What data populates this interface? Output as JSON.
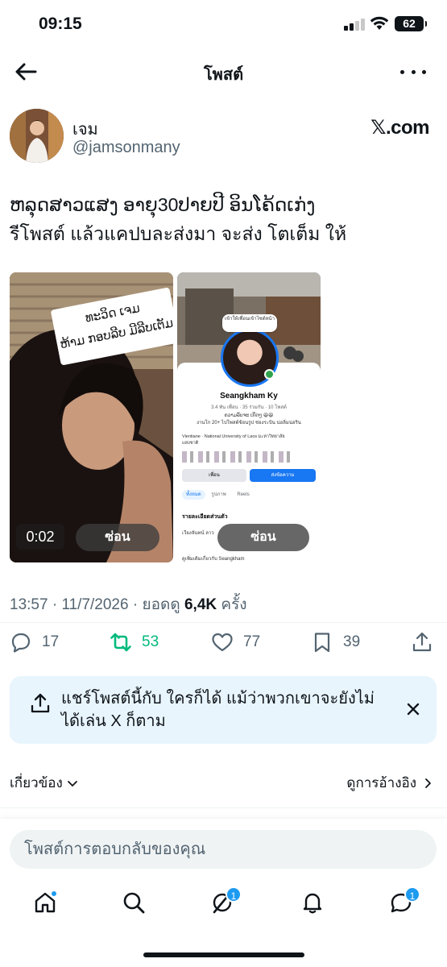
{
  "status_bar": {
    "time": "09:15",
    "battery": "62"
  },
  "header": {
    "title": "โพสต์"
  },
  "author": {
    "name": "เจม",
    "handle": "@jamsonmany",
    "source_badge": "𝕏.com"
  },
  "post": {
    "text_line1": "ຫລຸດສາວແສງ ອາຍຸ30ປາຍປີ ອິນໂຄ້ດເກ່ງ",
    "text_line2": "รีโพสต์  แล้วแคปบละส่งมา จะส่ง โตเต็ม ให้"
  },
  "media": {
    "left": {
      "video_time": "0:02",
      "hide_label": "ซ่อน",
      "sticker_line1": "ທະວິດ ເຈມ",
      "sticker_line2": "ຫ້າມ ກອບລີບ ມີລີບເຕັມ"
    },
    "right": {
      "hide_label": "ซ่อน",
      "profile_name": "Seangkham Ky",
      "profile_stats": "3.4 พัน เพื่อน · 35 ร่วมกัน · 10 โพสต์",
      "profile_bubble": "เข้าให้เพื่อนเข้าไซต์หน้า",
      "profile_bio_1": "ຄວາມລັບຈະ ເກີດໆ 😆😆",
      "profile_bio_2": "งานโก 20+ ไปโพสต์ช้อนรูป ช่องระบิน น่อลิ่มน่อริน",
      "profile_info_1": "Vientiane · National University of Laos มะหาวิทยาลัย",
      "profile_info_2": "แห่งชาติ",
      "friends_btn": "เพื่อน",
      "message_btn": "ส่งข้อความ",
      "tab_all": "ทั้งหมด",
      "tab_photos": "รูปภาพ",
      "tab_reels": "Reels",
      "section_title": "รายละเอียดส่วนตัว",
      "row_1": "เวียงจันทน์ ลาว",
      "row_2": "ดูเพิ่มเติมเกี่ยวกับ Seangkham"
    }
  },
  "meta": {
    "time": "13:57",
    "date": "11/7/2026",
    "views_label": "ยอดดู",
    "views": "6,4K",
    "views_suffix": "ครั้ง"
  },
  "actions": {
    "replies": "17",
    "reposts": "53",
    "likes": "77",
    "bookmarks": "39"
  },
  "share_banner": {
    "text": "แชร์โพสต์นี้กับ ใครก็ได้ แม้ว่าพวกเขาจะยังไม่ได้เล่น X ก็ตาม"
  },
  "links": {
    "related": "เกี่ยวข้อง",
    "quotes": "ดูการอ้างอิง"
  },
  "reply": {
    "placeholder": "โพสต์การตอบกลับของคุณ"
  },
  "nav": {
    "grok_badge": "1",
    "messages_badge": "1"
  },
  "colors": {
    "accent": "#1d9bf0",
    "repost_green": "#00ba7c",
    "secondary_text": "#536471",
    "banner_bg": "#e8f5fd"
  }
}
